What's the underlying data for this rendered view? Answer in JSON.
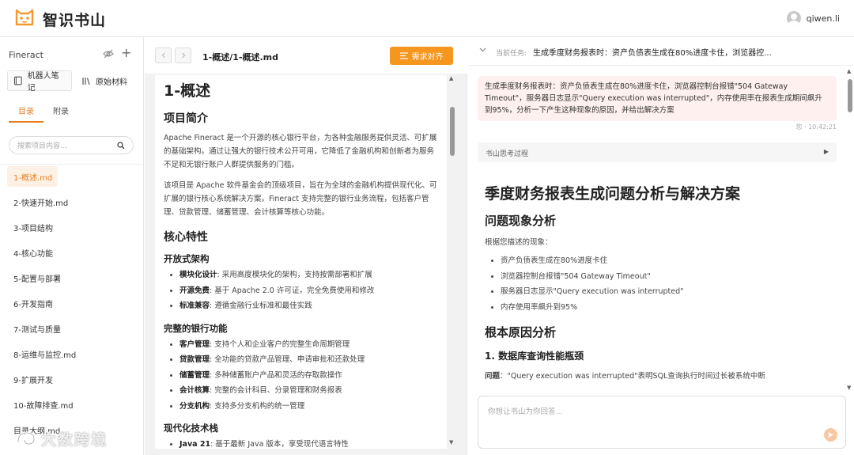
{
  "app": {
    "title": "智识书山",
    "username": "qiwen.li"
  },
  "sidebar": {
    "project": "Fineract",
    "sources": {
      "robot_notes": "机器人笔记",
      "raw_material": "原始材料"
    },
    "tabs": [
      "目录",
      "附录"
    ],
    "search_placeholder": "搜索项目内容...",
    "files": [
      "1-概述.md",
      "2-快速开始.md",
      "3-项目结构",
      "4-核心功能",
      "5-配置与部署",
      "6-开发指南",
      "7-测试与质量",
      "8-运维与监控.md",
      "9-扩展开发",
      "10-故障排查.md",
      "目录大纲.md"
    ],
    "watermark": "大数跨境"
  },
  "doc": {
    "path": "1-概述/1-概述.md",
    "align_button": "需求对齐",
    "h1": "1-概述",
    "intro_heading": "项目简介",
    "intro_p1": "Apache Fineract 是一个开源的核心银行平台，为各种金融服务提供灵活、可扩展的基础架构。通过让强大的银行技术公开可用，它降低了金融机构和创新者为服务不足和无银行账户人群提供服务的门槛。",
    "intro_p2": "该项目是 Apache 软件基金会的顶级项目，旨在为全球的金融机构提供现代化、可扩展的银行核心系统解决方案。Fineract 支持完整的银行业务流程，包括客户管理、贷款管理、储蓄管理、会计核算等核心功能。",
    "features_heading": "核心特性",
    "open_arch": {
      "heading": "开放式架构",
      "items": [
        {
          "k": "模块化设计",
          "v": ": 采用高度模块化的架构，支持按需部署和扩展"
        },
        {
          "k": "开源免费",
          "v": ": 基于 Apache 2.0 许可证，完全免费使用和修改"
        },
        {
          "k": "标准兼容",
          "v": ": 遵循金融行业标准和最佳实践"
        }
      ]
    },
    "banking": {
      "heading": "完整的银行功能",
      "items": [
        {
          "k": "客户管理",
          "v": ": 支持个人和企业客户的完整生命周期管理"
        },
        {
          "k": "贷款管理",
          "v": ": 全功能的贷款产品管理、申请审批和还款处理"
        },
        {
          "k": "储蓄管理",
          "v": ": 多种储蓄账户产品和灵活的存取款操作"
        },
        {
          "k": "会计核算",
          "v": ": 完整的会计科目、分录管理和财务报表"
        },
        {
          "k": "分支机构",
          "v": ": 支持多分支机构的统一管理"
        }
      ]
    },
    "modern": {
      "heading": "现代化技术栈",
      "items": [
        {
          "k": "Java 21",
          "v": ": 基于最新 Java 版本，享受现代语言特性"
        }
      ]
    }
  },
  "chat": {
    "task_label": "当前任务:",
    "task_text": "生成季度财务报表时：资产负债表生成在80%进度卡住，浏览器控...",
    "user_message": "生成季度财务报表时：资产负债表生成在80%进度卡住，浏览器控制台报错\"504 Gateway Timeout\"，服务器日志显示\"Query execution was interrupted\"，内存使用率在报表生成期间飙升到95%，分析一下产生这种现象的原因，并给出解决方案",
    "message_meta": "您 · 10:42:21",
    "thinking_label": "书山思考过程",
    "answer": {
      "title": "季度财务报表生成问题分析与解决方案",
      "phenomenon_heading": "问题现象分析",
      "phenomenon_intro": "根据您描述的现象：",
      "phenomenon_items": [
        "资产负债表生成在80%进度卡住",
        "浏览器控制台报错\"504 Gateway Timeout\"",
        "服务器日志显示\"Query execution was interrupted\"",
        "内存使用率飙升到95%"
      ],
      "root_heading": "根本原因分析",
      "root_sub": "1. 数据库查询性能瓶颈",
      "problem_label": "问题",
      "problem_text": "：\"Query execution was interrupted\"表明SQL查询执行时间过长被系统中断"
    },
    "input_placeholder": "你想让书山为你回答..."
  },
  "colors": {
    "accent": "#e67e22",
    "button": "#f5961e",
    "user_bubble": "#fdf0ee"
  }
}
